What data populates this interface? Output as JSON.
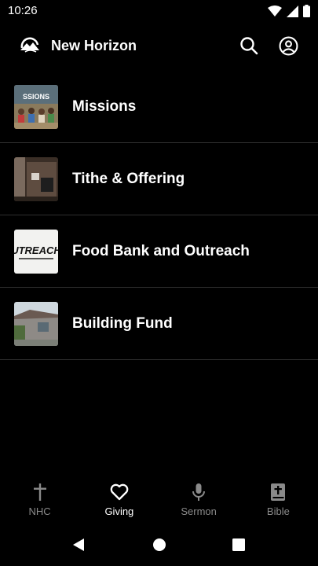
{
  "status_bar": {
    "time": "10:26",
    "icons": [
      "wifi-icon",
      "signal-icon",
      "battery-icon"
    ]
  },
  "app_bar": {
    "title": "New Horizon",
    "logo_icon": "mountain-logo-icon",
    "search_icon": "search-icon",
    "profile_icon": "account-circle-icon"
  },
  "giving_items": [
    {
      "label": "Missions",
      "thumb_text": "SSIONS"
    },
    {
      "label": "Tithe & Offering"
    },
    {
      "label": "Food Bank and Outreach",
      "thumb_text": "UTREACH"
    },
    {
      "label": "Building Fund"
    }
  ],
  "bottom_nav": [
    {
      "label": "NHC",
      "icon": "cross-icon",
      "active": false
    },
    {
      "label": "Giving",
      "icon": "heart-icon",
      "active": true
    },
    {
      "label": "Sermon",
      "icon": "microphone-icon",
      "active": false
    },
    {
      "label": "Bible",
      "icon": "bible-icon",
      "active": false
    }
  ],
  "colors": {
    "background": "#000000",
    "text": "#ffffff",
    "inactive": "#8a8a8a",
    "divider": "#2e2e2e"
  }
}
